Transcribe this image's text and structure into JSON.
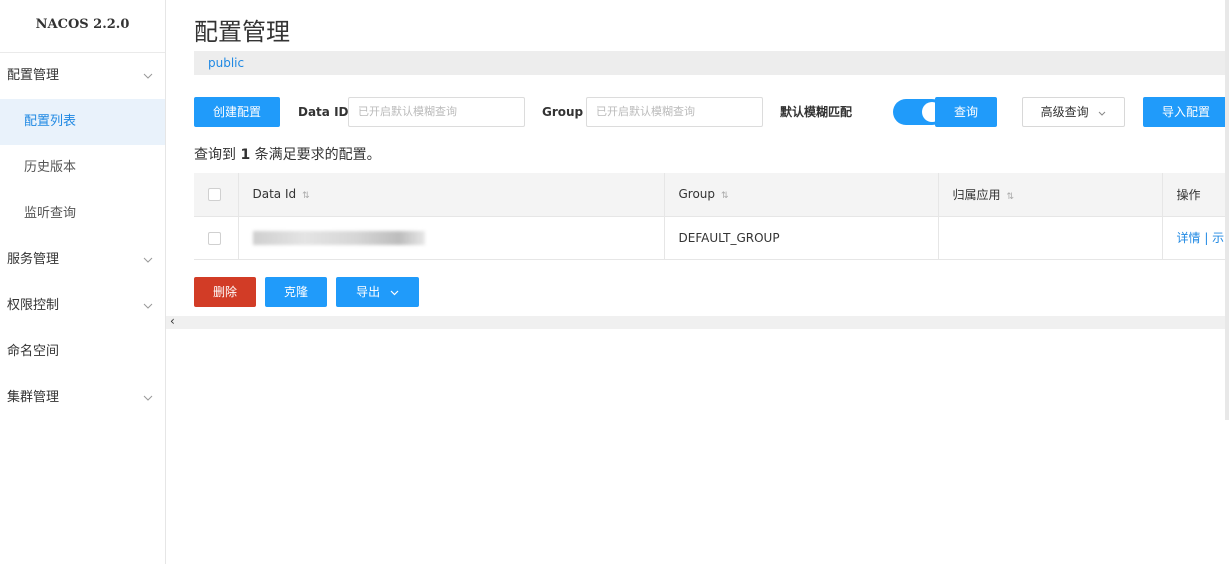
{
  "brand": "NACOS 2.2.0",
  "sidebar": {
    "items": [
      {
        "label": "配置管理",
        "type": "group"
      },
      {
        "label": "配置列表",
        "type": "sub"
      },
      {
        "label": "历史版本",
        "type": "sub"
      },
      {
        "label": "监听查询",
        "type": "sub"
      },
      {
        "label": "服务管理",
        "type": "group"
      },
      {
        "label": "权限控制",
        "type": "group"
      },
      {
        "label": "命名空间",
        "type": "plain"
      },
      {
        "label": "集群管理",
        "type": "group"
      }
    ]
  },
  "page": {
    "title": "配置管理",
    "namespace": "public"
  },
  "toolbar": {
    "create_label": "创建配置",
    "data_id_label": "Data ID",
    "data_id_placeholder": "已开启默认模糊查询",
    "group_label": "Group",
    "group_placeholder": "已开启默认模糊查询",
    "fuzzy_label": "默认模糊匹配",
    "fuzzy_enabled": true,
    "query_label": "查询",
    "advanced_label": "高级查询",
    "import_label": "导入配置"
  },
  "result": {
    "prefix": "查询到",
    "count": "1",
    "suffix": "条满足要求的配置。"
  },
  "table": {
    "columns": [
      "Data Id",
      "Group",
      "归属应用",
      "操作"
    ],
    "rows": [
      {
        "data_id": "",
        "group": "DEFAULT_GROUP",
        "app": "",
        "actions": "详情 | 示"
      }
    ]
  },
  "bulk": {
    "delete_label": "删除",
    "clone_label": "克隆",
    "export_label": "导出"
  },
  "colors": {
    "primary": "#209bfa",
    "danger": "#d23c26",
    "active_bg": "#e9f2fb",
    "link": "#2089e3"
  }
}
